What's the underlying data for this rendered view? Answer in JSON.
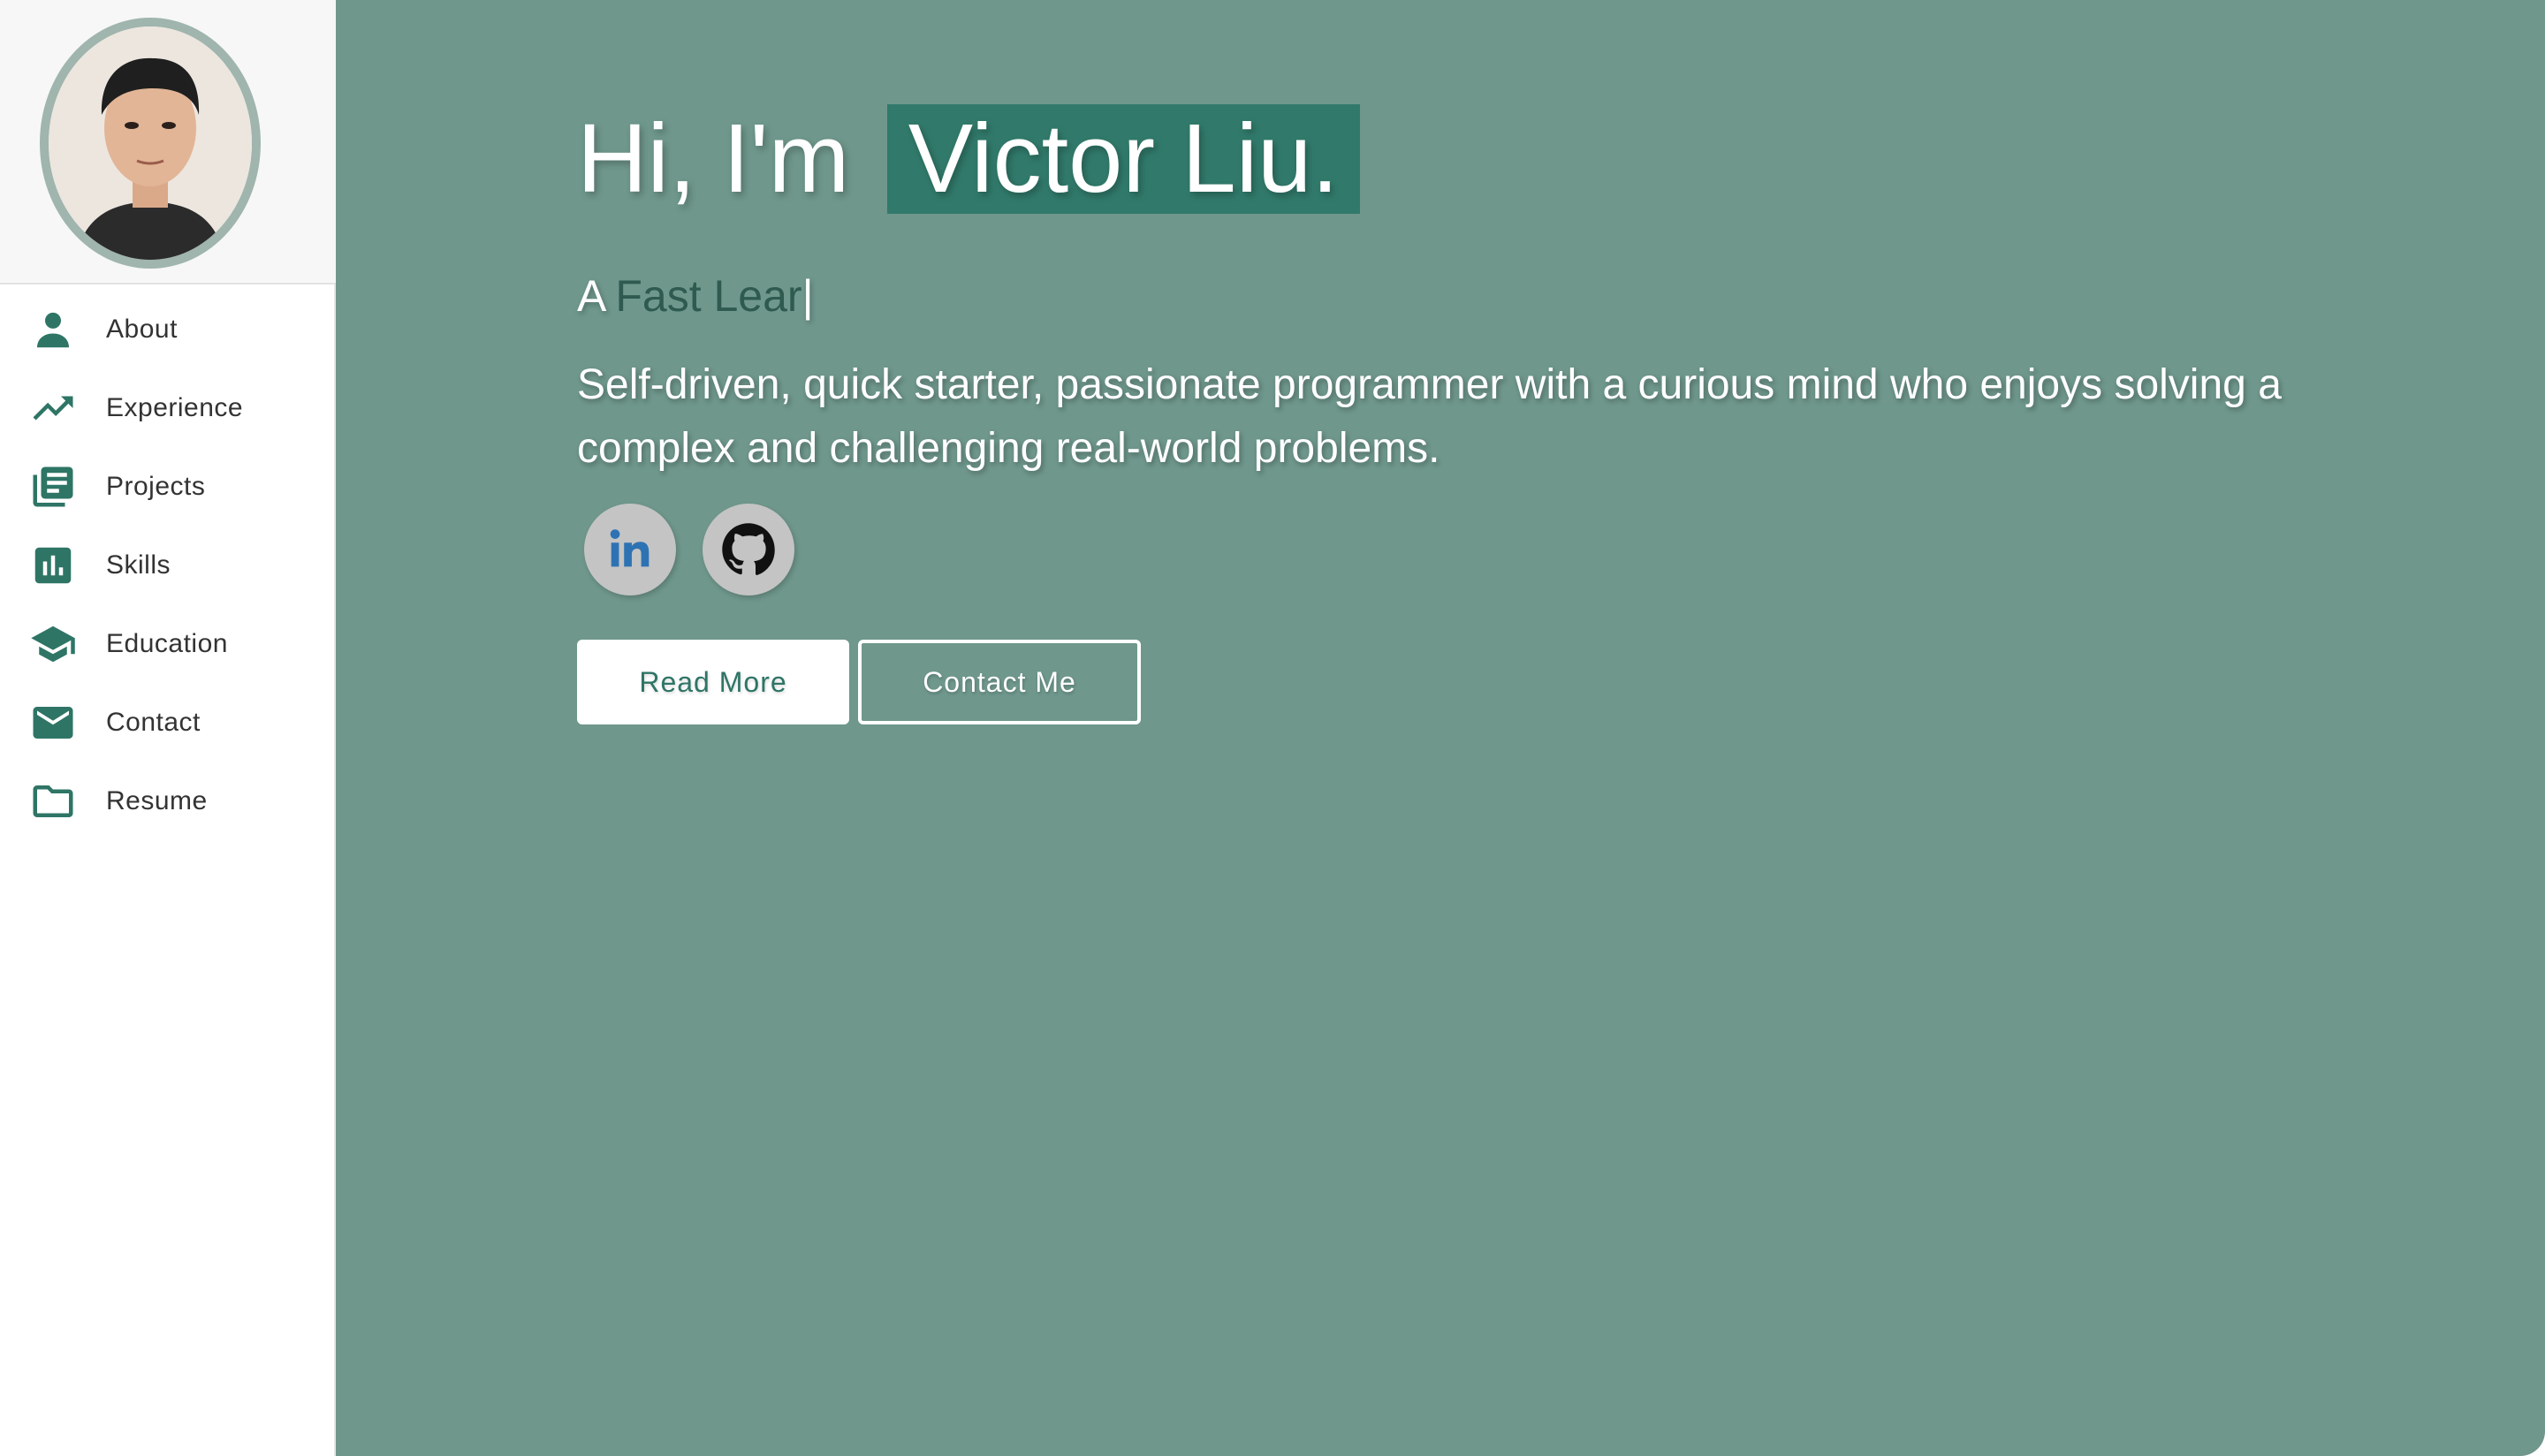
{
  "sidebar": {
    "avatar_alt": "Victor Liu portrait",
    "items": [
      {
        "label": "About",
        "icon": "person-icon"
      },
      {
        "label": "Experience",
        "icon": "trending-up-icon"
      },
      {
        "label": "Projects",
        "icon": "library-books-icon"
      },
      {
        "label": "Skills",
        "icon": "bar-chart-icon"
      },
      {
        "label": "Education",
        "icon": "graduation-cap-icon"
      },
      {
        "label": "Contact",
        "icon": "envelope-icon"
      },
      {
        "label": "Resume",
        "icon": "folder-icon"
      }
    ]
  },
  "hero": {
    "greeting_prefix": "Hi, I'm",
    "name": "Victor Liu.",
    "typed_prefix": "A",
    "typed_word": "Fast Lear",
    "typed_cursor": "|",
    "bio": "Self-driven, quick starter, passionate programmer with a curious mind who enjoys solving a complex and challenging real-world problems.",
    "socials": [
      {
        "name": "LinkedIn",
        "icon": "linkedin-icon"
      },
      {
        "name": "GitHub",
        "icon": "github-icon"
      }
    ],
    "read_more_label": "Read More",
    "contact_label": "Contact Me"
  },
  "colors": {
    "accent": "#2e7566",
    "hero_background": "#6f978c",
    "name_highlight": "#317a6b",
    "sidebar_background": "#ffffff"
  }
}
